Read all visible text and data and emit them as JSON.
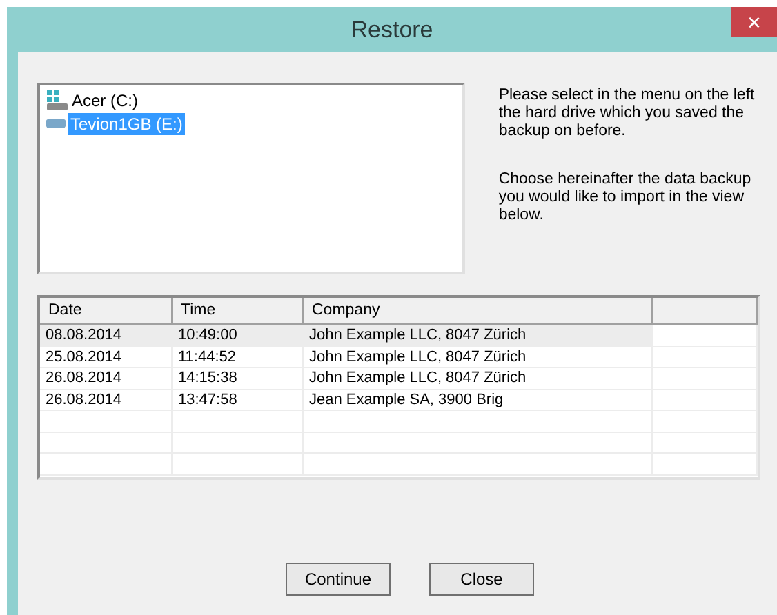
{
  "window": {
    "title": "Restore",
    "close_glyph": "✕"
  },
  "drives": [
    {
      "label": "Acer (C:)",
      "kind": "system",
      "selected": false
    },
    {
      "label": "Tevion1GB (E:)",
      "kind": "removable",
      "selected": true
    }
  ],
  "instructions": [
    "Please select in the menu on the left the hard drive which you saved the backup on before.",
    "Choose hereinafter the data backup you would like to import in the view below."
  ],
  "table": {
    "columns": [
      "Date",
      "Time",
      "Company"
    ],
    "rows": [
      {
        "cells": [
          "08.08.2014",
          "10:49:00",
          "John Example LLC, 8047 Zürich"
        ],
        "selected": true
      },
      {
        "cells": [
          "25.08.2014",
          "11:44:52",
          "John Example LLC, 8047 Zürich"
        ],
        "selected": false
      },
      {
        "cells": [
          "26.08.2014",
          "14:15:38",
          "John Example LLC, 8047 Zürich"
        ],
        "selected": false
      },
      {
        "cells": [
          "26.08.2014",
          "13:47:58",
          "Jean Example SA, 3900 Brig"
        ],
        "selected": false
      }
    ]
  },
  "buttons": [
    "Continue",
    "Close"
  ]
}
